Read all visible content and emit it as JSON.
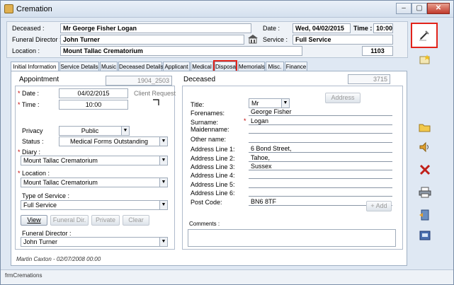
{
  "window": {
    "title": "Cremation",
    "minimize_label": "–",
    "restore_label": "▢",
    "close_label": "✕"
  },
  "header": {
    "deceased_label": "Deceased :",
    "deceased_value": "Mr George Fisher Logan",
    "date_label": "Date :",
    "date_value": "Wed, 04/02/2015",
    "time_label": "Time :",
    "time_value": "10:00",
    "funeral_director_label": "Funeral Director :",
    "funeral_director_value": "John Turner",
    "service_label": "Service :",
    "service_value": "Full Service",
    "location_label": "Location :",
    "location_value": "Mount Tallac Crematorium",
    "record_number": "1103"
  },
  "tabs": [
    {
      "label": "Initial Information",
      "active": true
    },
    {
      "label": "Service Details"
    },
    {
      "label": "Music"
    },
    {
      "label": "Deceased Details"
    },
    {
      "label": "Applicant"
    },
    {
      "label": "Medical"
    },
    {
      "label": "Disposal",
      "highlighted": true
    },
    {
      "label": "Memorials"
    },
    {
      "label": "Misc."
    },
    {
      "label": "Finance"
    }
  ],
  "appointment": {
    "section_label": "Appointment",
    "number": "1904_2503",
    "date_label": "Date :",
    "date_value": "04/02/2015",
    "client_request_label": "Client Request",
    "time_label": "Time :",
    "time_value": "10:00",
    "privacy_label": "Privacy",
    "privacy_value": "Public",
    "status_label": "Status :",
    "status_value": "Medical Forms Outstanding",
    "diary_label": "Diary :",
    "diary_value": "Mount Tallac Crematorium",
    "location_label": "Location :",
    "location_value": "Mount Tallac Crematorium",
    "type_of_service_label": "Type of Service  :",
    "type_of_service_value": "Full Service",
    "view_button": "View",
    "funeral_dir_button": "Funeral Dir.",
    "private_button": "Private",
    "clear_button": "Clear",
    "funeral_director_label": "Funeral Director :",
    "funeral_director_value": "John Turner"
  },
  "deceased": {
    "section_label": "Deceased",
    "number": "3715",
    "address_button": "Address",
    "title_label": "Title:",
    "title_value": "Mr",
    "forenames_label": "Forenames:",
    "forenames_value": "George Fisher",
    "surname_label": "Surname:",
    "surname_value": "Logan",
    "maidenname_label": "Maidenname:",
    "maidenname_value": "",
    "other_name_label": "Other name:",
    "other_name_value": "",
    "address1_label": "Address Line 1:",
    "address1_value": "6 Bond Street,",
    "address2_label": "Address Line 2:",
    "address2_value": "Tahoe,",
    "address3_label": "Address Line 3:",
    "address3_value": "Sussex",
    "address4_label": "Address Line 4:",
    "address4_value": "",
    "address5_label": "Address Line 5:",
    "address5_value": "",
    "address6_label": "Address Line 6:",
    "address6_value": "",
    "postcode_label": "Post Code:",
    "postcode_value": "BN6 8TF",
    "add_button": "+ Add",
    "comments_label": "Comments :",
    "comments_value": ""
  },
  "footer": {
    "audit": "Martin Caxton - 02/07/2008 00:00",
    "form_name": "frmCremations"
  },
  "icons": {
    "edit": "pencil-icon",
    "new": "new-record-icon",
    "open": "folder-icon",
    "music": "speaker-icon",
    "delete": "delete-icon",
    "print": "printer-icon",
    "exit": "exit-door-icon",
    "save": "save-screen-icon"
  },
  "colors": {
    "highlight": "#e2231a",
    "required": "#c00000"
  }
}
